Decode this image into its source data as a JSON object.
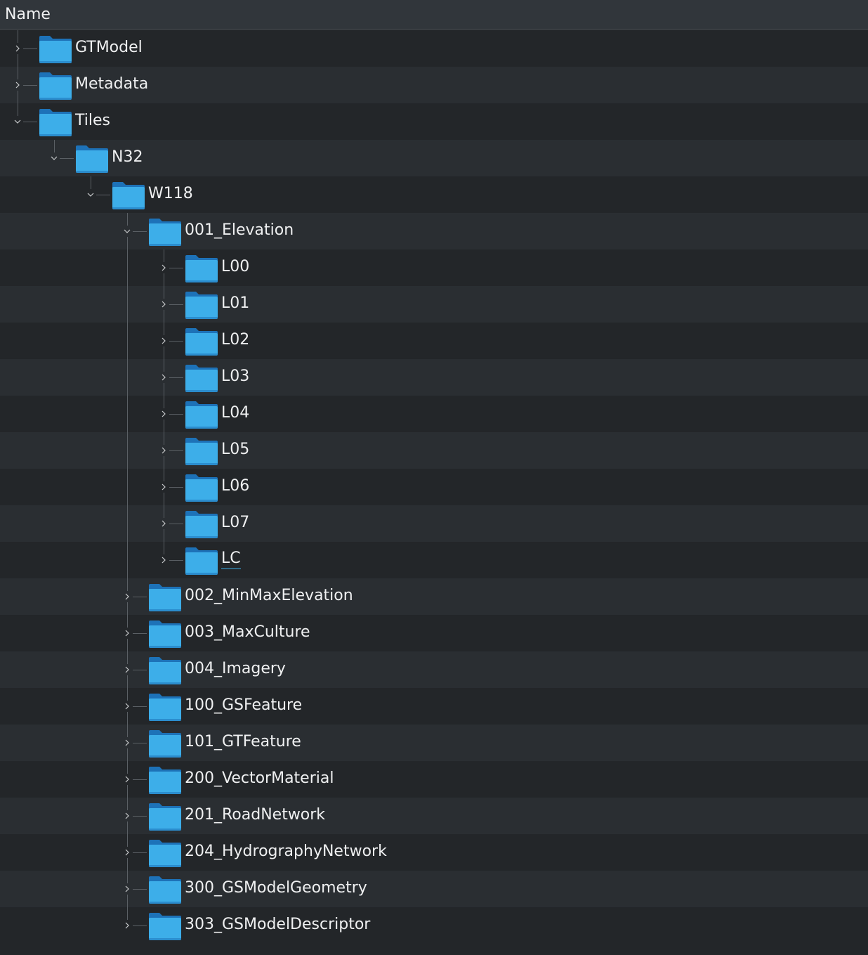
{
  "header": {
    "column_name": "Name"
  },
  "tree": [
    {
      "label": "GTModel",
      "depth": 0,
      "expanded": false,
      "icon": "folder-icon"
    },
    {
      "label": "Metadata",
      "depth": 0,
      "expanded": false,
      "icon": "folder-icon"
    },
    {
      "label": "Tiles",
      "depth": 0,
      "expanded": true,
      "icon": "folder-icon"
    },
    {
      "label": "N32",
      "depth": 1,
      "expanded": true,
      "icon": "folder-icon"
    },
    {
      "label": "W118",
      "depth": 2,
      "expanded": true,
      "icon": "folder-icon"
    },
    {
      "label": "001_Elevation",
      "depth": 3,
      "expanded": true,
      "icon": "folder-icon"
    },
    {
      "label": "L00",
      "depth": 4,
      "expanded": false,
      "icon": "folder-icon"
    },
    {
      "label": "L01",
      "depth": 4,
      "expanded": false,
      "icon": "folder-icon"
    },
    {
      "label": "L02",
      "depth": 4,
      "expanded": false,
      "icon": "folder-icon"
    },
    {
      "label": "L03",
      "depth": 4,
      "expanded": false,
      "icon": "folder-icon"
    },
    {
      "label": "L04",
      "depth": 4,
      "expanded": false,
      "icon": "folder-icon"
    },
    {
      "label": "L05",
      "depth": 4,
      "expanded": false,
      "icon": "folder-icon"
    },
    {
      "label": "L06",
      "depth": 4,
      "expanded": false,
      "icon": "folder-icon"
    },
    {
      "label": "L07",
      "depth": 4,
      "expanded": false,
      "icon": "folder-icon"
    },
    {
      "label": "LC",
      "depth": 4,
      "expanded": false,
      "icon": "folder-icon",
      "current": true
    },
    {
      "label": "002_MinMaxElevation",
      "depth": 3,
      "expanded": false,
      "icon": "folder-icon"
    },
    {
      "label": "003_MaxCulture",
      "depth": 3,
      "expanded": false,
      "icon": "folder-icon"
    },
    {
      "label": "004_Imagery",
      "depth": 3,
      "expanded": false,
      "icon": "folder-icon"
    },
    {
      "label": "100_GSFeature",
      "depth": 3,
      "expanded": false,
      "icon": "folder-icon"
    },
    {
      "label": "101_GTFeature",
      "depth": 3,
      "expanded": false,
      "icon": "folder-icon"
    },
    {
      "label": "200_VectorMaterial",
      "depth": 3,
      "expanded": false,
      "icon": "folder-icon"
    },
    {
      "label": "201_RoadNetwork",
      "depth": 3,
      "expanded": false,
      "icon": "folder-icon"
    },
    {
      "label": "204_HydrographyNetwork",
      "depth": 3,
      "expanded": false,
      "icon": "folder-icon"
    },
    {
      "label": "300_GSModelGeometry",
      "depth": 3,
      "expanded": false,
      "icon": "folder-icon"
    },
    {
      "label": "303_GSModelDescriptor",
      "depth": 3,
      "expanded": false,
      "icon": "folder-icon"
    }
  ],
  "colors": {
    "background": "#232629",
    "row_alt": "#2a2e32",
    "header": "#31363b",
    "text": "#eff0f1",
    "folder_light": "#3daee9",
    "folder_dark": "#1d72b8",
    "accent": "#3daee9"
  }
}
